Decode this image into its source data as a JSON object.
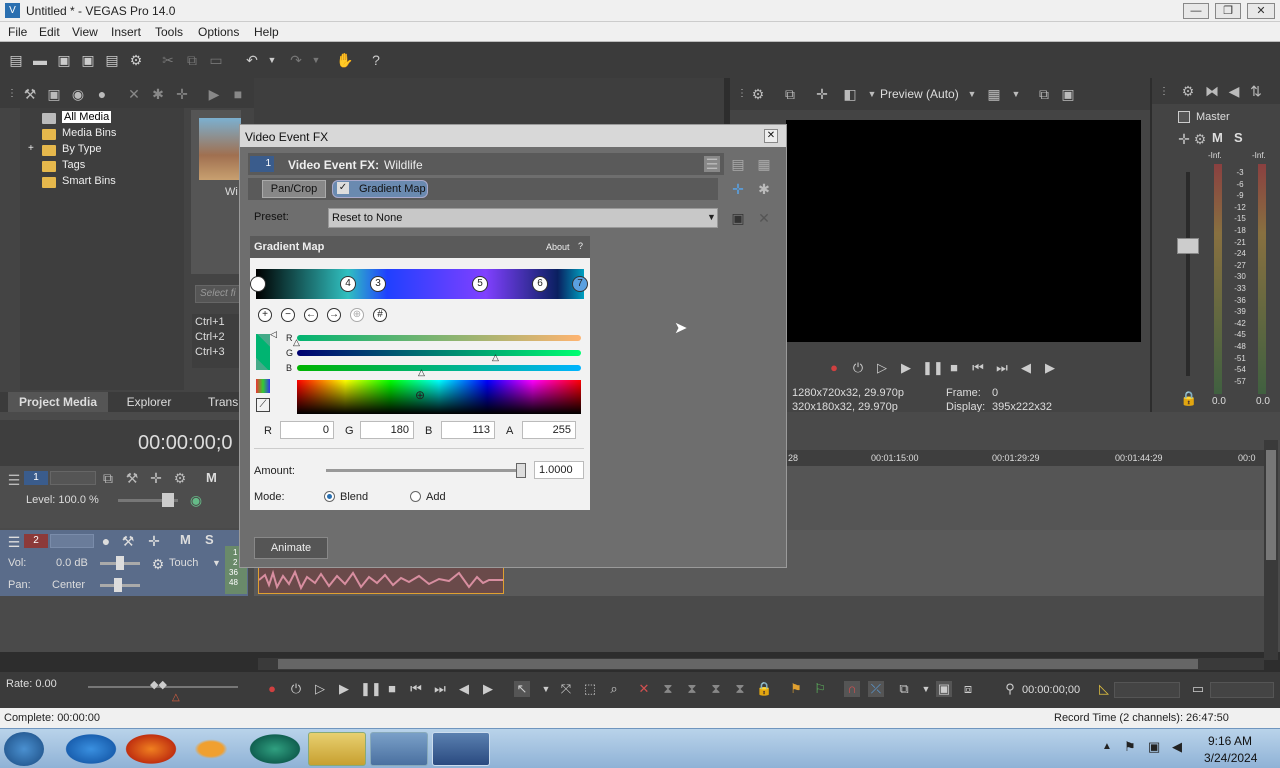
{
  "window": {
    "title": "Untitled * - VEGAS Pro 14.0",
    "min": "—",
    "max": "❐",
    "close": "✕"
  },
  "menu": [
    "File",
    "Edit",
    "View",
    "Insert",
    "Tools",
    "Options",
    "Help"
  ],
  "media_tree": {
    "items": [
      "All Media",
      "Media Bins",
      "By Type",
      "Tags",
      "Smart Bins"
    ],
    "expander": "+"
  },
  "media_thumb_label": "Wi",
  "search_placeholder": "Select fi",
  "shortcuts": [
    "Ctrl+1",
    "Ctrl+2",
    "Ctrl+3"
  ],
  "bottom_tabs": [
    "Project Media",
    "Explorer",
    "Transi"
  ],
  "preview": {
    "mode_label": "Preview (Auto)",
    "project_res": "1280x720x32, 29.970p",
    "preview_res": "320x180x32, 29.970p",
    "frame_label": "Frame:",
    "frame_value": "0",
    "display_label": "Display:",
    "display_value": "395x222x32"
  },
  "master": {
    "label": "Master",
    "m": "M",
    "s": "S",
    "inf_left": "-Inf.",
    "inf_right": "-Inf.",
    "scale": [
      "3",
      "6",
      "9",
      "12",
      "15",
      "18",
      "21",
      "24",
      "27",
      "30",
      "33",
      "36",
      "39",
      "42",
      "45",
      "48",
      "51",
      "54",
      "57"
    ],
    "readout_left": "0.0",
    "readout_right": "0.0"
  },
  "timecode": "00:00:00;0",
  "track1": {
    "num": "1",
    "level": "Level: 100.0 %",
    "m": "M"
  },
  "track2": {
    "num": "2",
    "vol_label": "Vol:",
    "vol_value": "0.0 dB",
    "pan_label": "Pan:",
    "pan_value": "Center",
    "touch": "Touch",
    "m": "M",
    "s": "S",
    "side_labels": [
      "1",
      "2",
      "36",
      "48"
    ]
  },
  "ruler": [
    "28",
    "00:01:15:00",
    "00:01:29:29",
    "00:01:44:29",
    "00:0"
  ],
  "transport": {
    "rate": "Rate: 0.00",
    "timecode": "00:00:00;00"
  },
  "status": {
    "complete": "Complete: 00:00:00",
    "record_time": "Record Time (2 channels): 26:47:50"
  },
  "dialog": {
    "title": "Video Event FX",
    "close": "✕",
    "chain_num": "1",
    "chain_label": "Video Event FX:",
    "chain_name": "Wildlife",
    "plugins": [
      "Pan/Crop",
      "Gradient Map"
    ],
    "preset_label": "Preset:",
    "preset_value": "Reset to None",
    "fx_title": "Gradient Map",
    "about": "About",
    "about_q": "?",
    "nodes": [
      "4",
      "3",
      "5",
      "6",
      "7"
    ],
    "rgb_labels": [
      "R",
      "G",
      "B"
    ],
    "r_value": "0",
    "g_value": "180",
    "b_value": "113",
    "a_value": "255",
    "a_label": "A",
    "amount_label": "Amount:",
    "amount_value": "1.0000",
    "amount_fraction": 1.0,
    "mode_label": "Mode:",
    "mode_options": [
      "Blend",
      "Add"
    ],
    "mode_selected": "Blend",
    "animate": "Animate"
  },
  "clock": {
    "time": "9:16 AM",
    "date": "3/24/2024"
  },
  "colors": {
    "accent": "#5aa0e0",
    "track_blue": "#3a5c8c",
    "audio_wave": "#d88ea0",
    "event_border": "#e0a030"
  }
}
